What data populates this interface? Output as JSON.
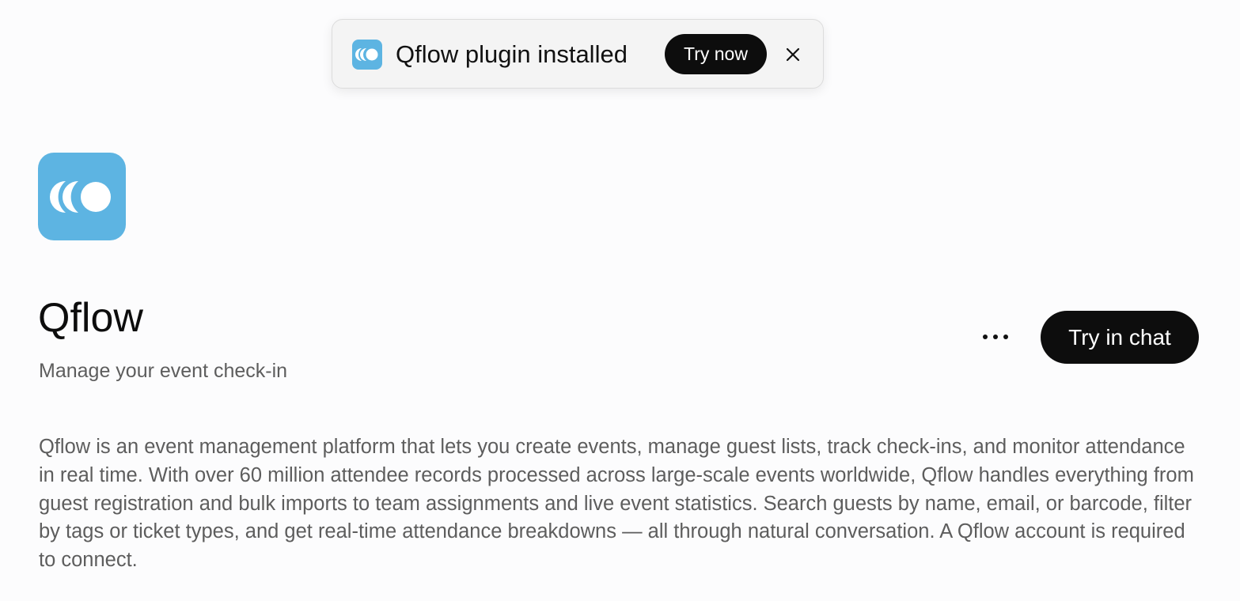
{
  "toast": {
    "icon": "qflow-logo-icon",
    "message": "Qflow plugin installed",
    "action_label": "Try now",
    "close_icon": "close-icon"
  },
  "plugin": {
    "icon": "qflow-logo-icon",
    "name": "Qflow",
    "tagline": "Manage your event check-in",
    "description": "Qflow is an event management platform that lets you create events, manage guest lists, track check-ins, and monitor attendance in real time. With over 60 million attendee records processed across large-scale events worldwide, Qflow handles everything from guest registration and bulk imports to team assignments and live event statistics. Search guests by name, email, or barcode, filter by tags or ticket types, and get real-time attendance breakdowns — all through natural conversation. A Qflow account is required to connect."
  },
  "actions": {
    "more_icon": "more-options-icon",
    "primary_label": "Try in chat"
  },
  "colors": {
    "brand": "#5db4e2",
    "button_bg": "#0d0d0d",
    "background": "#fcfcfd"
  }
}
